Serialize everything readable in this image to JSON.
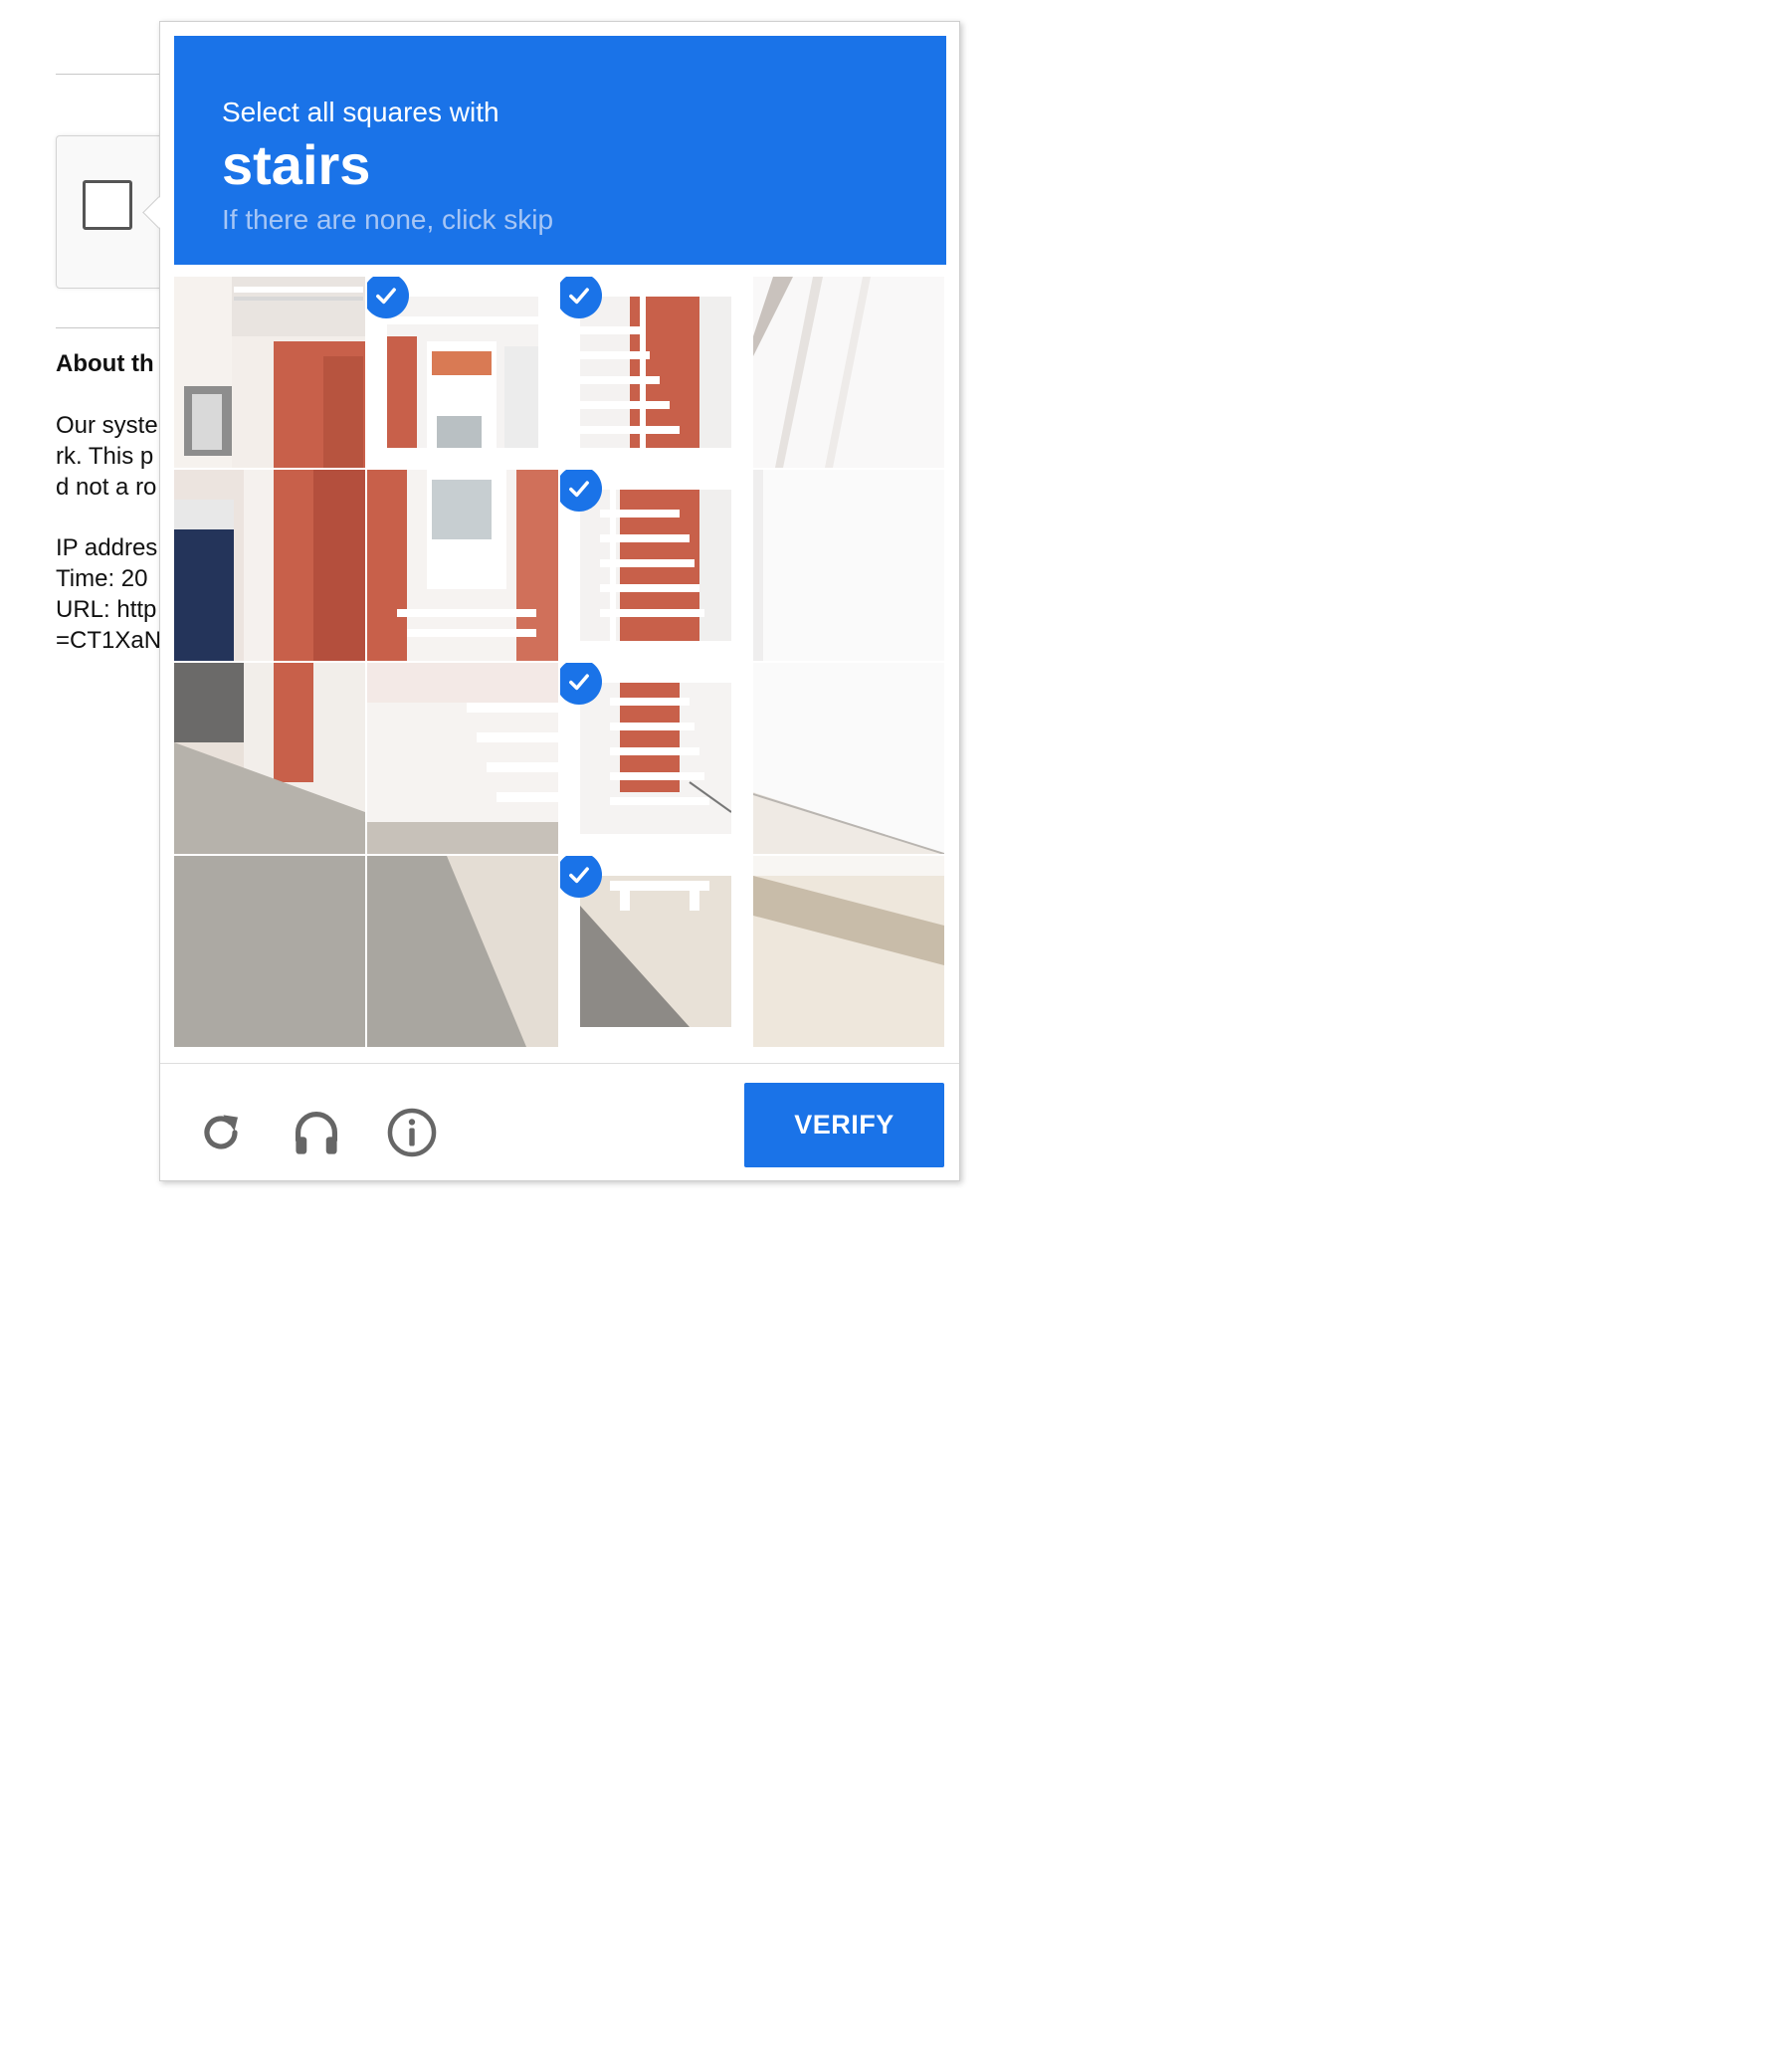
{
  "background_page": {
    "about_title": "About th",
    "body_lines": [
      "Our syste",
      "rk. This p",
      "d not a ro"
    ],
    "info_lines": [
      "IP addres",
      "Time: 20",
      "URL: http",
      "=CT1XaN"
    ]
  },
  "captcha": {
    "instruction_line": "Select all squares with",
    "keyword": "stairs",
    "hint": "If there are none, click skip",
    "grid": {
      "rows": 4,
      "cols": 4,
      "selected_tiles": [
        [
          0,
          1
        ],
        [
          0,
          2
        ],
        [
          1,
          2
        ],
        [
          2,
          2
        ],
        [
          3,
          2
        ]
      ]
    },
    "footer": {
      "reload_icon": "reload-icon",
      "audio_icon": "headphones-icon",
      "info_icon": "info-icon",
      "verify_label": "VERIFY"
    }
  },
  "colors": {
    "accent": "#1a73e8",
    "hint": "#a7c6f5"
  }
}
